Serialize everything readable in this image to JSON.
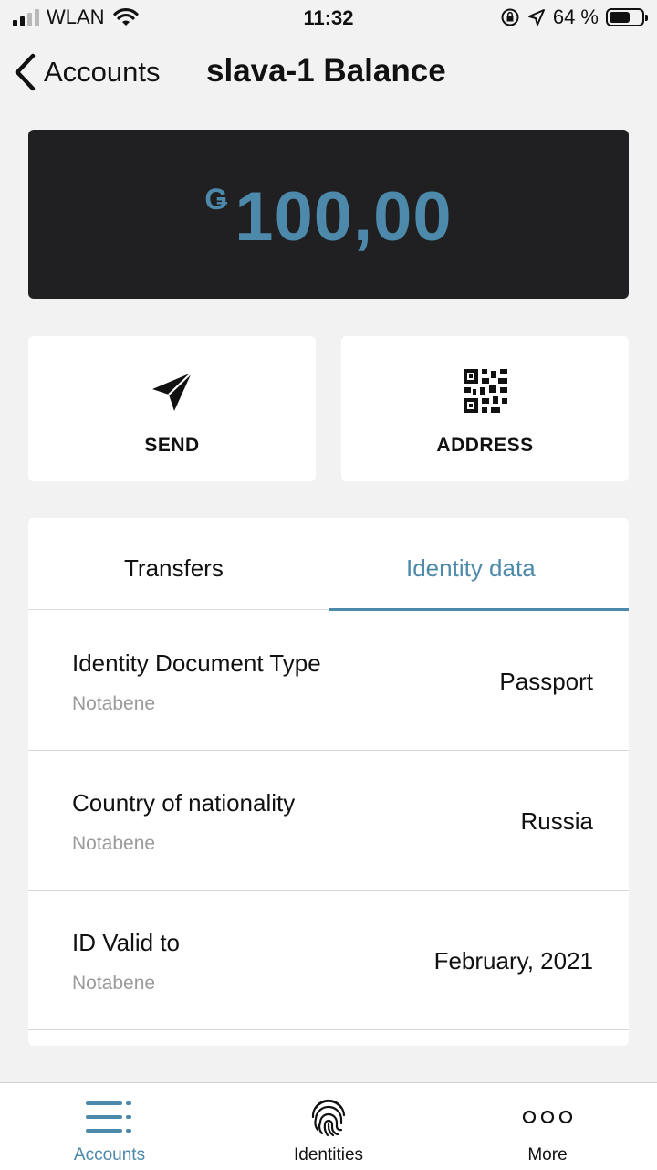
{
  "status": {
    "carrier": "WLAN",
    "time": "11:32",
    "battery": "64 %"
  },
  "nav": {
    "back_label": "Accounts",
    "title": "slava-1 Balance"
  },
  "balance": {
    "currency_symbol": "Ǥ",
    "amount": "100,00"
  },
  "actions": {
    "send_label": "SEND",
    "address_label": "ADDRESS"
  },
  "tabs": [
    {
      "label": "Transfers"
    },
    {
      "label": "Identity data"
    }
  ],
  "identity_rows": [
    {
      "title": "Identity Document Type",
      "sub": "Notabene",
      "value": "Passport"
    },
    {
      "title": "Country of nationality",
      "sub": "Notabene",
      "value": "Russia"
    },
    {
      "title": "ID Valid to",
      "sub": "Notabene",
      "value": "February, 2021"
    }
  ],
  "tabbar": {
    "accounts": "Accounts",
    "identities": "Identities",
    "more": "More"
  },
  "colors": {
    "accent": "#4d89aa",
    "dark_card": "#202022",
    "background": "#f2f2f2"
  }
}
